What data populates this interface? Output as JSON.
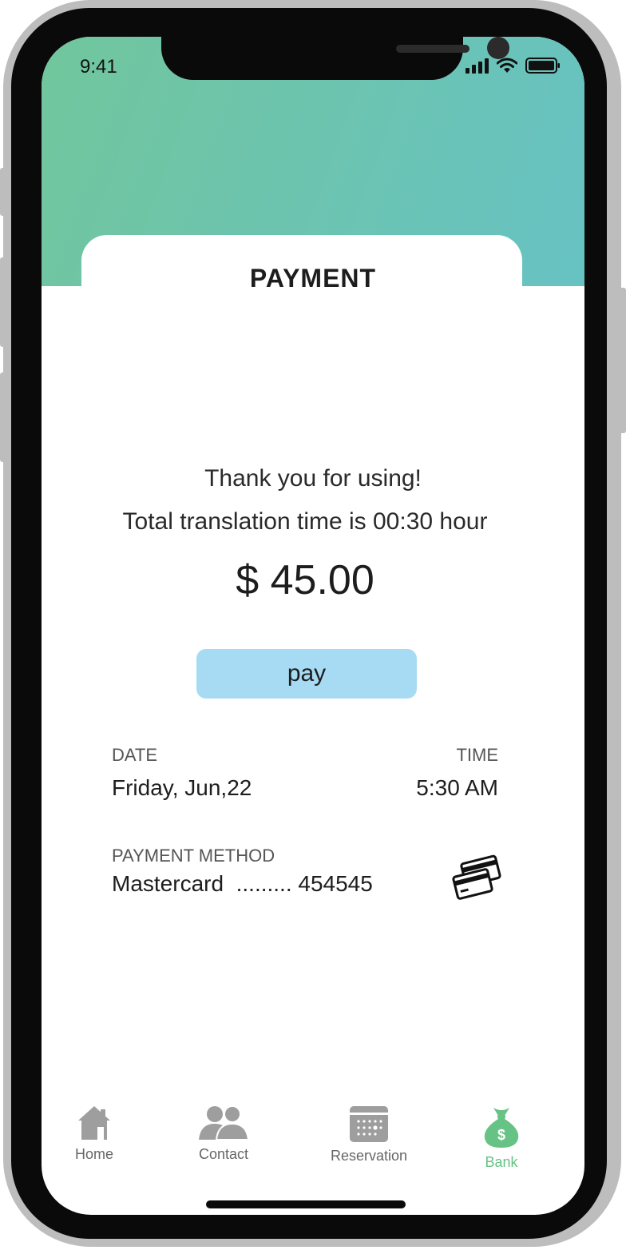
{
  "status_bar": {
    "time": "9:41"
  },
  "page": {
    "title": "PAYMENT"
  },
  "summary": {
    "thanks": "Thank you for using!",
    "total_time": "Total translation time is 00:30 hour",
    "amount": "$ 45.00"
  },
  "actions": {
    "pay_label": "pay"
  },
  "details": {
    "date_label": "DATE",
    "date_value": "Friday, Jun,22",
    "time_label": "TIME",
    "time_value": "5:30 AM",
    "method_label": "PAYMENT METHOD",
    "method_value": "Mastercard  ......... 454545"
  },
  "tabbar": {
    "items": [
      {
        "label": "Home",
        "icon": "home-icon"
      },
      {
        "label": "Contact",
        "icon": "contacts-icon"
      },
      {
        "label": "Reservation",
        "icon": "calendar-icon"
      },
      {
        "label": "Bank",
        "icon": "money-bag-icon",
        "active": true
      }
    ]
  },
  "colors": {
    "header_gradient_start": "#71c69c",
    "header_gradient_end": "#67c2c3",
    "pay_button": "#a7dbf3",
    "active_tab": "#66c285",
    "inactive_tab": "#9e9e9e"
  }
}
